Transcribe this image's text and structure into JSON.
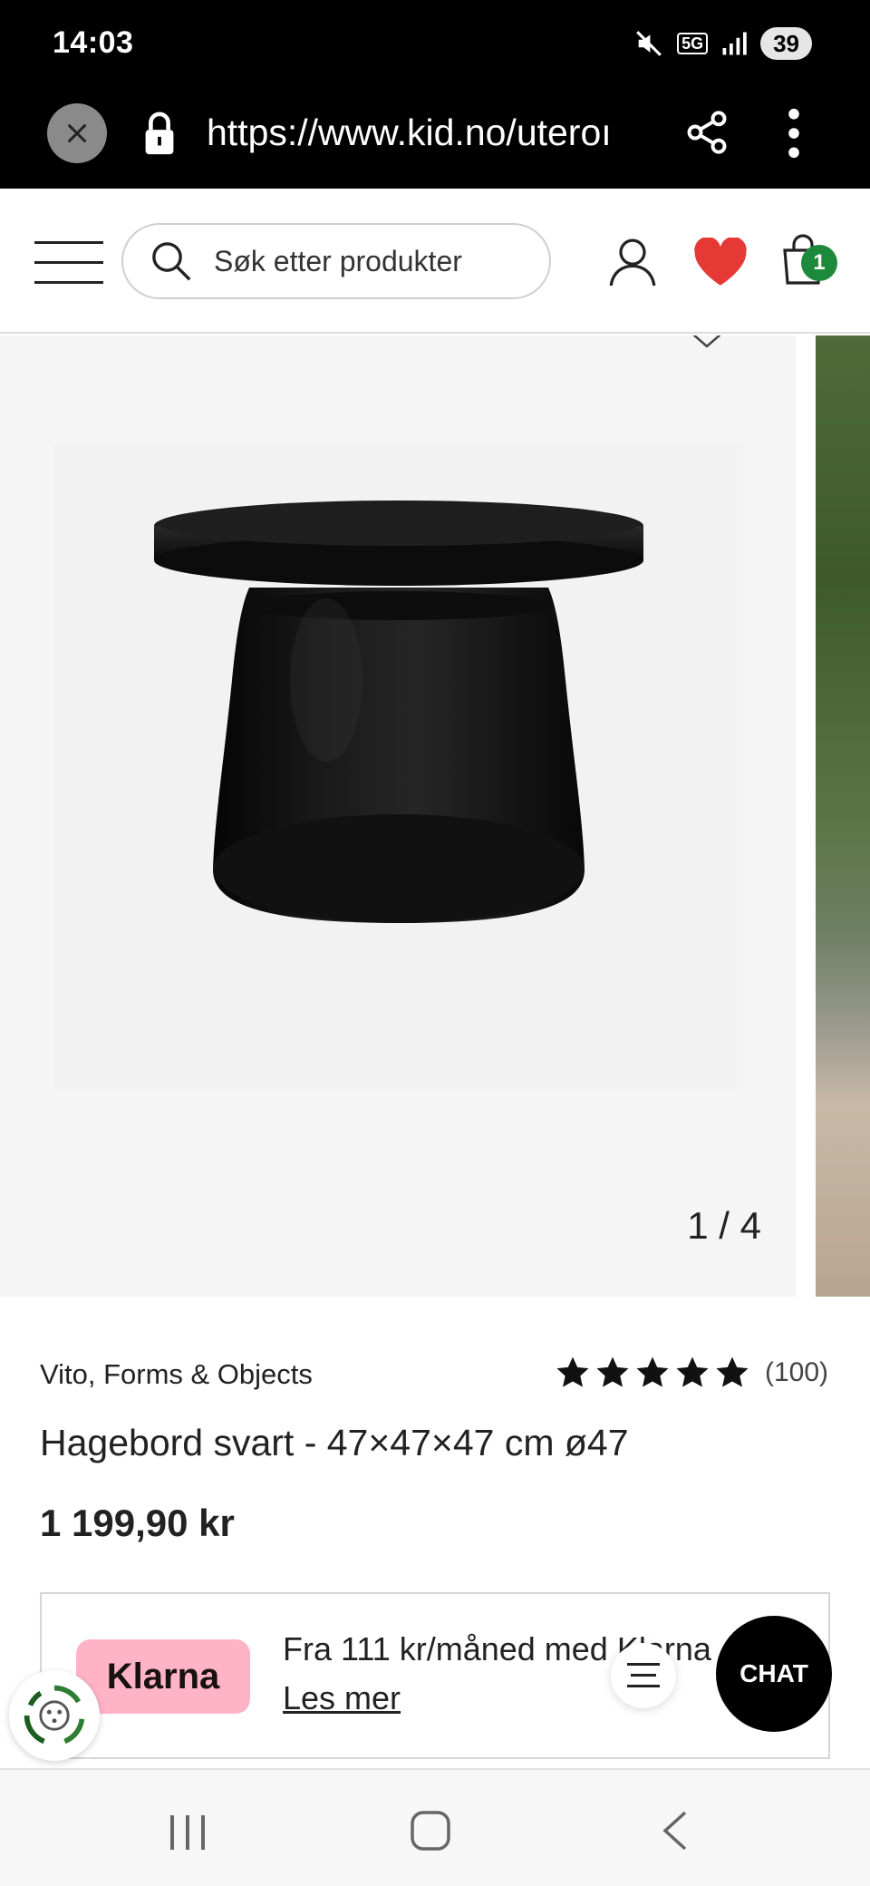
{
  "status_bar": {
    "time": "14:03",
    "network": "5G",
    "battery": "39"
  },
  "browser": {
    "url": "https://www.kid.no/uterom/hagemobler",
    "url_visible": "https://www.kid.no/uteroı"
  },
  "header": {
    "search_placeholder": "Søk etter produkter",
    "cart_count": "1",
    "colors": {
      "heart": "#e53935",
      "cart_badge": "#1c8a3a"
    }
  },
  "gallery": {
    "counter": "1 / 4"
  },
  "product": {
    "brand": "Vito, Forms & Objects",
    "rating_stars": 5,
    "rating_count": "(100)",
    "title": "Hagebord svart - 47×47×47 cm ø47",
    "price": "1 199,90 kr"
  },
  "klarna": {
    "logo": "Klarna",
    "text": "Fra 111 kr/måned med Klarna",
    "link": "Les mer",
    "colors": {
      "logo_bg": "#ffb3c7"
    }
  },
  "chat": {
    "label": "CHAT"
  },
  "icons": {
    "close": "close-icon",
    "lock": "lock-icon",
    "share": "share-icon",
    "menu": "more-vert-icon",
    "hamburger": "hamburger-icon",
    "search": "search-icon",
    "user": "user-icon",
    "heart": "heart-icon",
    "cart": "cart-icon",
    "star": "star-icon",
    "eco": "recycle-icon"
  }
}
